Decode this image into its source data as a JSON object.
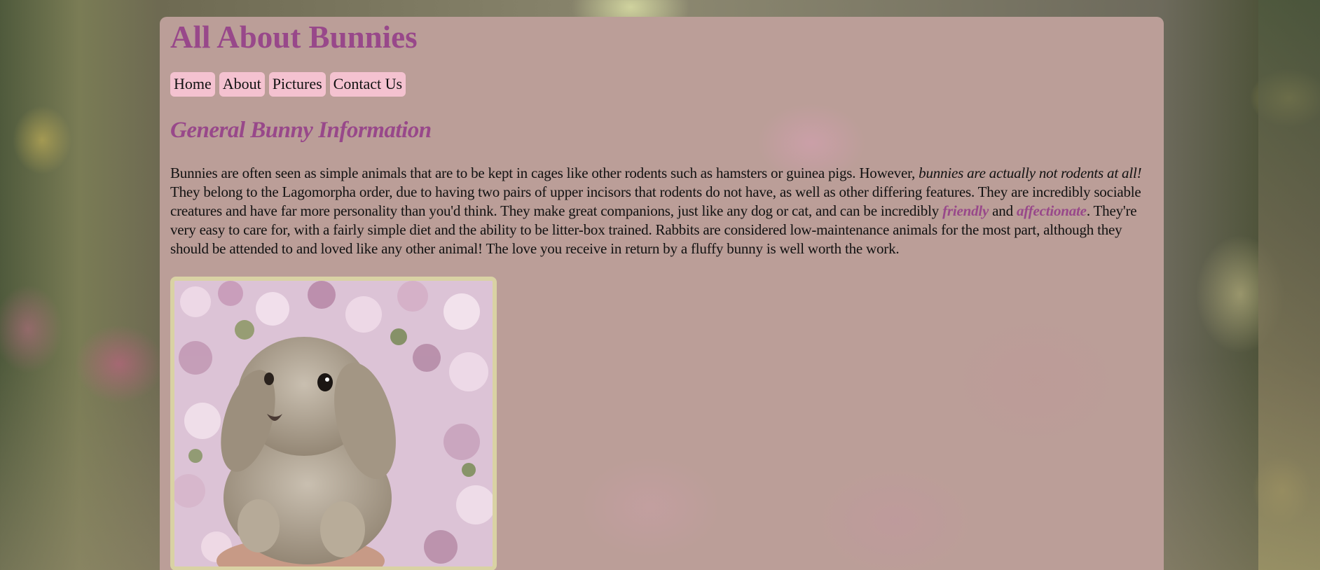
{
  "site": {
    "title": "All About Bunnies"
  },
  "nav": {
    "items": [
      {
        "label": "Home"
      },
      {
        "label": "About"
      },
      {
        "label": "Pictures"
      },
      {
        "label": "Contact Us"
      }
    ]
  },
  "section": {
    "heading": "General Bunny Information",
    "paragraph": {
      "part1": "Bunnies are often seen as simple animals that are to be kept in cages like other rodents such as hamsters or guinea pigs. However, ",
      "emphasis": "bunnies are actually not rodents at all!",
      "part2": " They belong to the Lagomorpha order, due to having two pairs of upper incisors that rodents do not have, as well as other differing features. They are incredibly sociable creatures and have far more personality than you'd think. They make great companions, just like any dog or cat, and can be incredibly ",
      "highlight1": "friendly",
      "joiner": " and ",
      "highlight2": "affectionate",
      "part3": ". They're very easy to care for, with a fairly simple diet and the ability to be litter-box trained. Rabbits are considered low-maintenance animals for the most part, although they should be attended to and loved like any other animal! The love you receive in return by a fluffy bunny is well worth the work."
    }
  },
  "colors": {
    "accent": "#98488a",
    "nav_bg": "#f4c2d0",
    "frame": "#d9d2a4"
  }
}
